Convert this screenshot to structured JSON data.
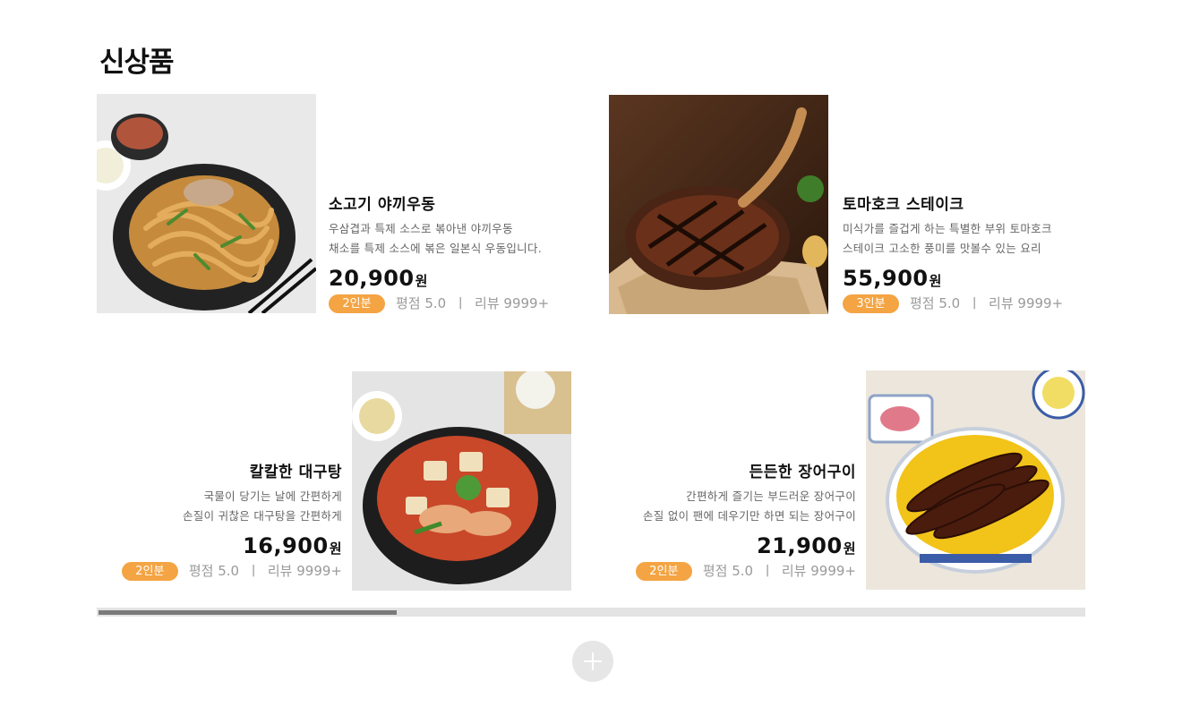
{
  "section": {
    "title": "신상품"
  },
  "products": [
    {
      "name": "소고기 야끼우동",
      "desc_line1": "우삼겹과 특제 소스로 볶아낸 야끼우동",
      "desc_line2": "채소를 특제 소스에 볶은 일본식 우동입니다.",
      "price": "20,900",
      "currency": "원",
      "serving": "2인분",
      "rating": "평점 5.0",
      "separator": "ㅣ",
      "reviews": "리뷰 9999+"
    },
    {
      "name": "토마호크 스테이크",
      "desc_line1": "미식가를 즐겁게 하는 특별한 부위 토마호크",
      "desc_line2": "스테이크 고소한 풍미를 맛볼수 있는 요리",
      "price": "55,900",
      "currency": "원",
      "serving": "3인분",
      "rating": "평점 5.0",
      "separator": "ㅣ",
      "reviews": "리뷰 9999+"
    },
    {
      "name": "칼칼한 대구탕",
      "desc_line1": "국물이 당기는 날에 간편하게",
      "desc_line2": "손질이 귀찮은 대구탕을 간편하게",
      "price": "16,900",
      "currency": "원",
      "serving": "2인분",
      "rating": "평점 5.0",
      "separator": "ㅣ",
      "reviews": "리뷰 9999+"
    },
    {
      "name": "든든한 장어구이",
      "desc_line1": "간편하게 즐기는 부드러운 장어구이",
      "desc_line2": "손질 없이 팬에 데우기만 하면 되는 장어구이",
      "price": "21,900",
      "currency": "원",
      "serving": "2인분",
      "rating": "평점 5.0",
      "separator": "ㅣ",
      "reviews": "리뷰 9999+"
    }
  ],
  "scrollbar": {
    "position_fraction": 0.3
  },
  "more_button": {
    "icon": "plus-icon"
  },
  "colors": {
    "badge": "#f4a443",
    "scroll_track": "#e3e3e3",
    "scroll_thumb": "#7a7a7a",
    "more_button": "#e6e6e6"
  }
}
